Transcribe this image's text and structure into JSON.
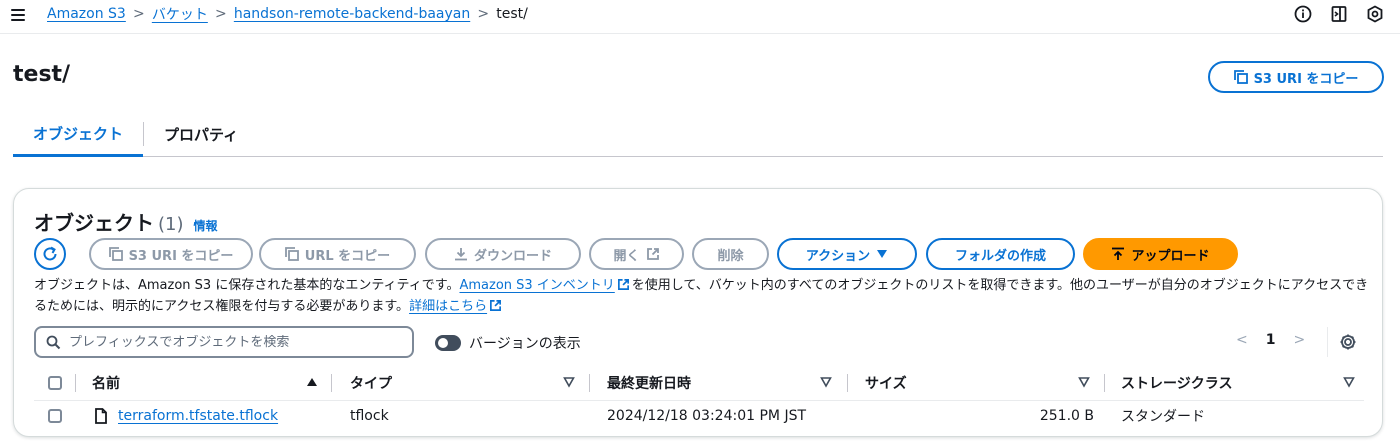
{
  "breadcrumb": {
    "items": [
      "Amazon S3",
      "バケット",
      "handson-remote-backend-baayan"
    ],
    "current": "test/"
  },
  "page": {
    "title": "test/",
    "copy_s3_uri_label": "S3 URI をコピー"
  },
  "tabs": [
    {
      "label": "オブジェクト",
      "active": true
    },
    {
      "label": "プロパティ",
      "active": false
    }
  ],
  "objects_panel": {
    "title": "オブジェクト",
    "count": "(1)",
    "info_label": "情報",
    "buttons": {
      "copy_s3_uri": "S3 URI をコピー",
      "copy_url": "URL をコピー",
      "download": "ダウンロード",
      "open": "開く",
      "delete": "削除",
      "actions": "アクション",
      "create_folder": "フォルダの作成",
      "upload": "アップロード"
    },
    "description": {
      "part1": "オブジェクトは、Amazon S3 に保存された基本的なエンティティです。",
      "inventory_link": "Amazon S3 インベントリ",
      "part2": "を使用して、バケット内のすべてのオブジェクトのリストを取得できます。他のユーザーが自分のオブジェクトにアクセスできるためには、明示的にアクセス権限を付与する必要があります。",
      "learn_more_link": "詳細はこちら"
    },
    "search_placeholder": "プレフィックスでオブジェクトを検索",
    "versions_toggle_label": "バージョンの表示",
    "pagination": {
      "current_page": "1"
    },
    "table": {
      "headers": [
        "名前",
        "タイプ",
        "最終更新日時",
        "サイズ",
        "ストレージクラス"
      ],
      "rows": [
        {
          "name": "terraform.tfstate.tflock",
          "type": "tflock",
          "last_modified": "2024/12/18 03:24:01 PM JST",
          "size": "251.0 B",
          "storage_class": "スタンダード"
        }
      ]
    }
  },
  "colors": {
    "link": "#0972d3",
    "primary_orange": "#ff9900",
    "disabled": "#8d99a8",
    "text": "#16191f"
  },
  "icons": [
    "menu-icon",
    "info-circle-icon",
    "document-icon",
    "settings-gear-icon",
    "copy-icon",
    "refresh-icon",
    "download-icon",
    "external-link-icon",
    "caret-down-icon",
    "upload-icon",
    "search-icon",
    "file-icon",
    "chevron-left-icon",
    "chevron-right-icon",
    "sort-asc-icon",
    "sort-desc-icon"
  ]
}
